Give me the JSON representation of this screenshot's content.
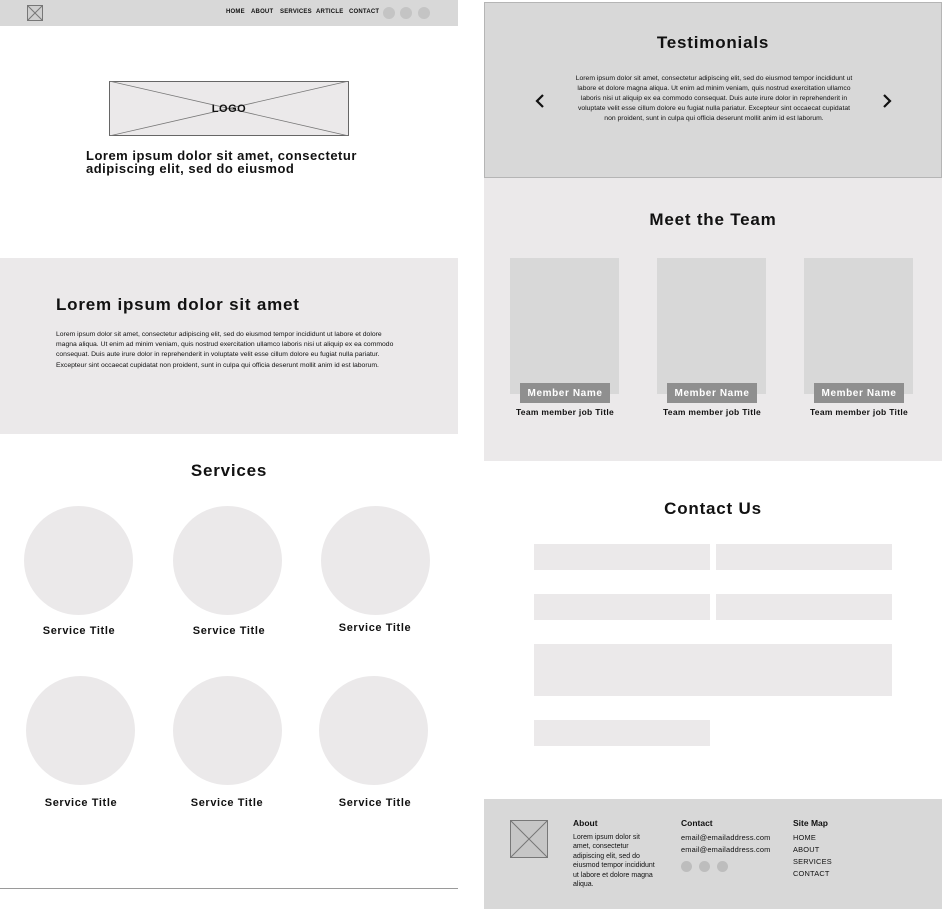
{
  "nav": {
    "links": [
      "HOME",
      "ABOUT",
      "SERVICES",
      "ARTICLE",
      "CONTACT"
    ]
  },
  "hero": {
    "logo_text": "LOGO",
    "tagline": "Lorem ipsum dolor sit amet, consectetur adipiscing elit, sed do eiusmod"
  },
  "about": {
    "heading": "Lorem ipsum dolor sit amet",
    "body": "Lorem ipsum dolor sit amet, consectetur adipiscing elit, sed do eiusmod tempor incididunt ut labore et dolore magna aliqua. Ut enim ad minim veniam, quis nostrud exercitation ullamco laboris nisi ut aliquip ex ea commodo consequat. Duis aute irure dolor in reprehenderit in voluptate velit esse cillum dolore eu fugiat nulla pariatur. Excepteur sint occaecat cupidatat non proident, sunt in culpa qui officia deserunt mollit anim id est laborum."
  },
  "services": {
    "heading": "Services",
    "items": [
      "Service Title",
      "Service Title",
      "Service Title",
      "Service Title",
      "Service Title",
      "Service Title"
    ]
  },
  "testimonials": {
    "heading": "Testimonials",
    "quote": "Lorem ipsum dolor sit amet, consectetur adipiscing elit, sed do eiusmod tempor incididunt ut labore et dolore magna aliqua. Ut enim ad minim veniam, quis nostrud exercitation ullamco laboris nisi ut aliquip ex ea commodo consequat. Duis aute irure dolor in reprehenderit in voluptate velit esse cillum dolore eu fugiat nulla pariatur. Excepteur sint occaecat cupidatat non proident, sunt in culpa qui officia deserunt mollit anim id est laborum.",
    "prev_icon": "chevron-left-icon",
    "next_icon": "chevron-right-icon"
  },
  "team": {
    "heading": "Meet the Team",
    "members": [
      {
        "name": "Member Name",
        "job": "Team member job Title"
      },
      {
        "name": "Member Name",
        "job": "Team member job Title"
      },
      {
        "name": "Member Name",
        "job": "Team member job Title"
      }
    ]
  },
  "contact": {
    "heading": "Contact Us"
  },
  "footer": {
    "about_heading": "About",
    "about_text": "Lorem ipsum dolor sit amet, consectetur adipiscing elit, sed do eiusmod tempor incididunt ut labore et dolore magna aliqua.",
    "contact_heading": "Contact",
    "emails": [
      "email@emailaddress.com",
      "email@emailaddress.com"
    ],
    "sitemap_heading": "Site Map",
    "sitemap_links": [
      "HOME",
      "ABOUT",
      "SERVICES",
      "CONTACT"
    ]
  },
  "colors": {
    "panel_gray": "#d8d8d8",
    "light_gray": "#ebe9ea",
    "badge_gray": "#8f8f8f"
  }
}
